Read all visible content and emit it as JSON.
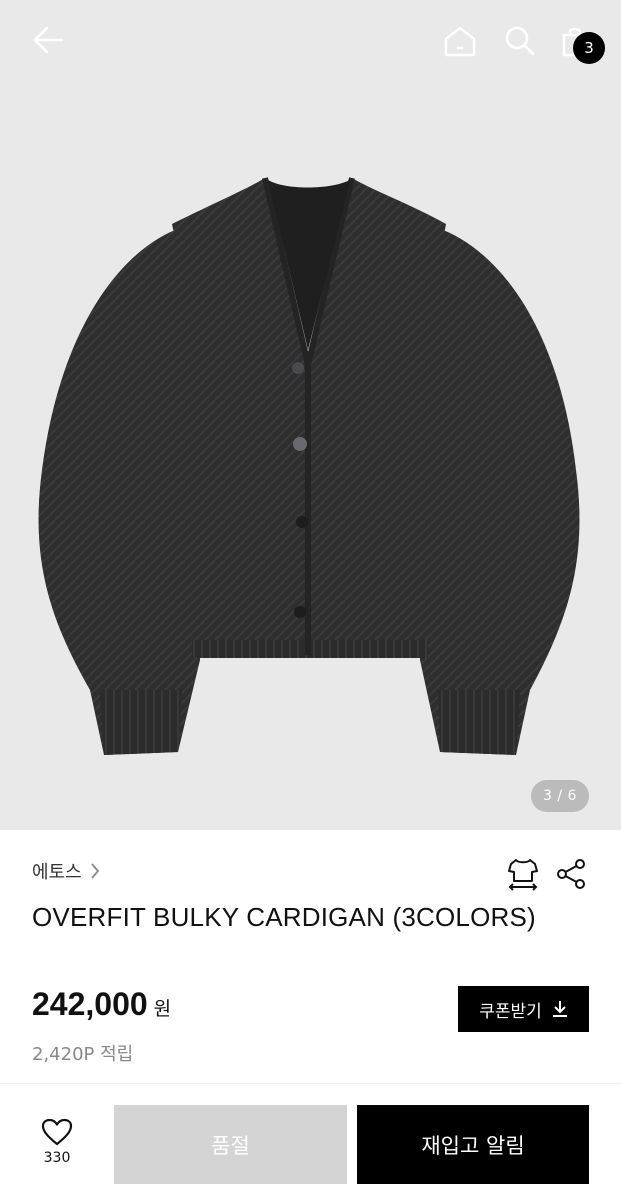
{
  "header": {
    "back_icon": "arrow-left-icon",
    "home_icon": "home-icon",
    "search_icon": "search-icon",
    "bag_icon": "shopping-bag-icon",
    "cart_count": "3"
  },
  "gallery": {
    "counter": "3 / 6",
    "current": 3,
    "total": 6,
    "background": "#e9e9e9"
  },
  "product": {
    "brand": "에토스",
    "brand_chevron_icon": "chevron-right-icon",
    "fit_icon": "size-fit-icon",
    "share_icon": "share-icon",
    "name": "OVERFIT BULKY CARDIGAN (3COLORS)",
    "price": "242,000",
    "price_unit": "원",
    "points": "2,420P 적립"
  },
  "coupon": {
    "label": "쿠폰받기",
    "icon": "download-icon"
  },
  "bottom_bar": {
    "like_icon": "heart-icon",
    "like_count": "330",
    "soldout_label": "품절",
    "restock_label": "재입고 알림"
  },
  "colors": {
    "accent": "#000000",
    "soldout": "#d4d4d4",
    "muted_text": "#888888"
  }
}
